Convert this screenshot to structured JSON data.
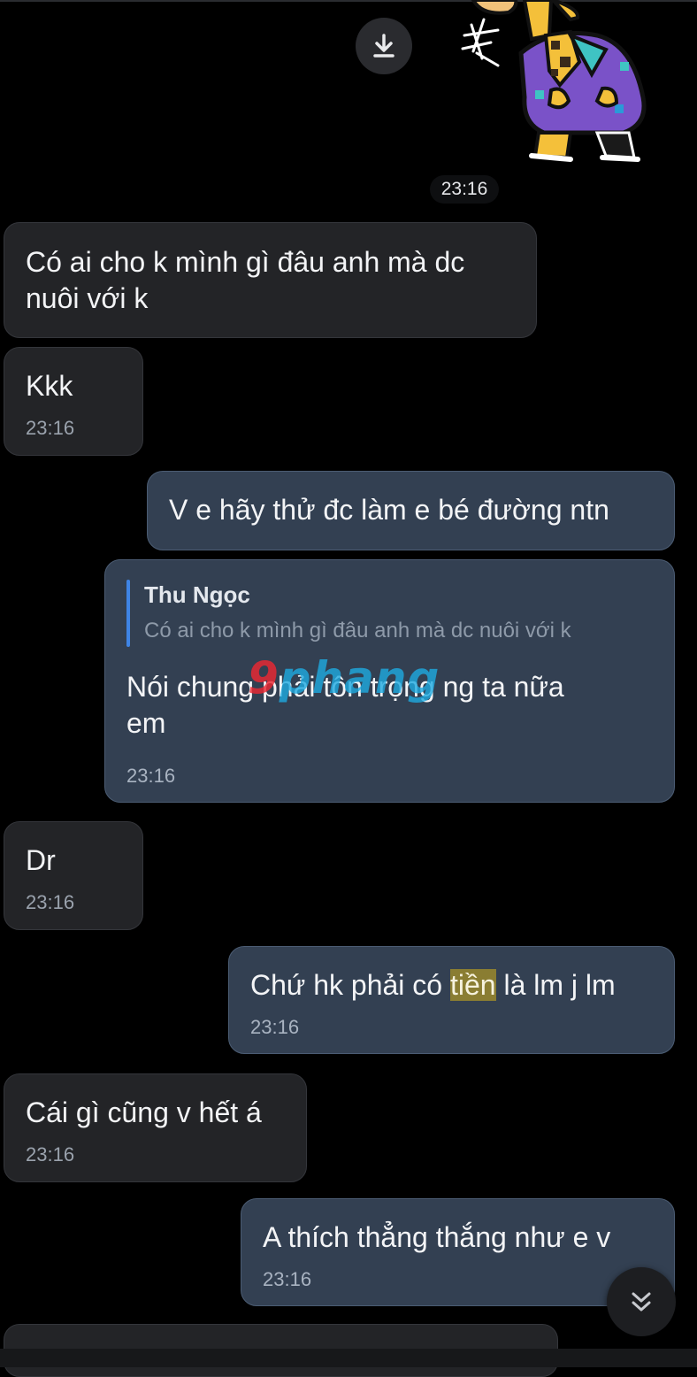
{
  "colors": {
    "background": "#000000",
    "incoming_bubble": "#232427",
    "outgoing_bubble": "#334052",
    "quote_bar": "#3f84e5",
    "highlight": "#8a7d32"
  },
  "icons": {
    "download": "download-icon",
    "scroll_down": "double-chevron-down-icon",
    "sticker": "giraffe-sticker"
  },
  "sticker": {
    "time": "23:16"
  },
  "messages": [
    {
      "direction": "in",
      "text": [
        "Có ai cho k mình gì đâu anh mà dc",
        "nuôi với k"
      ]
    },
    {
      "direction": "in",
      "text": [
        "Kkk"
      ],
      "time": "23:16"
    },
    {
      "direction": "out",
      "text": [
        "V e hãy thử đc làm e bé đường ntn"
      ]
    },
    {
      "direction": "out",
      "reply_to": {
        "name": "Thu Ngọc",
        "text": "Có ai cho k mình gì đâu anh mà dc nuôi với k"
      },
      "text": [
        "Nói chung phải tôn trọng ng ta nữa",
        "em"
      ],
      "time": "23:16"
    },
    {
      "direction": "in",
      "text": [
        "Dr"
      ],
      "time": "23:16"
    },
    {
      "direction": "out",
      "text_before": "Chứ hk phải có ",
      "highlight": "tiền",
      "text_after": " là lm j lm",
      "time": "23:16"
    },
    {
      "direction": "in",
      "text": [
        "Cái gì cũng v hết á"
      ],
      "time": "23:16"
    },
    {
      "direction": "out",
      "text": [
        "A thích thẳng thắng như e v"
      ],
      "time": "23:16"
    }
  ],
  "watermark": {
    "first": "9",
    "rest": "phang"
  }
}
